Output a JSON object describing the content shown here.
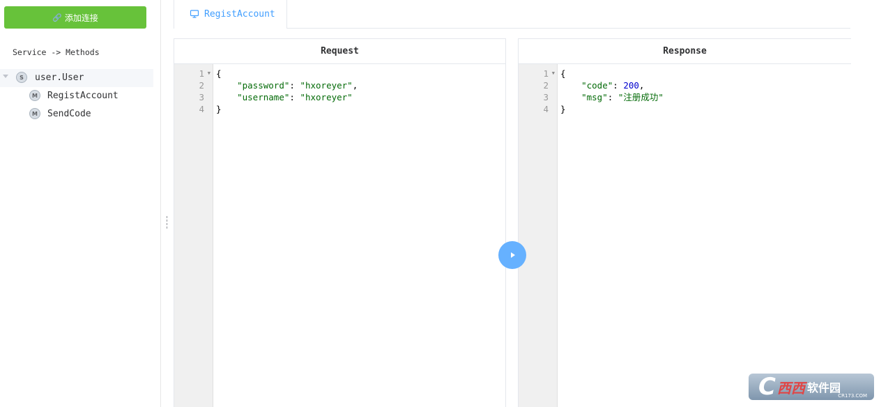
{
  "sidebar": {
    "add_button_label": "添加连接",
    "header": "Service -> Methods",
    "service": {
      "badge": "S",
      "name": "user.User"
    },
    "methods": [
      {
        "badge": "M",
        "name": "RegistAccount"
      },
      {
        "badge": "M",
        "name": "SendCode"
      }
    ]
  },
  "tabs": [
    {
      "label": "RegistAccount",
      "active": true
    }
  ],
  "request": {
    "title": "Request",
    "line_numbers": [
      "1",
      "2",
      "3",
      "4"
    ],
    "code": {
      "open": "{",
      "password_key": "\"password\"",
      "password_val": "\"hxoreyer\"",
      "username_key": "\"username\"",
      "username_val": "\"hxoreyer\"",
      "close": "}"
    }
  },
  "response": {
    "title": "Response",
    "line_numbers": [
      "1",
      "2",
      "3",
      "4"
    ],
    "code": {
      "open": "{",
      "code_key": "\"code\"",
      "code_val": "200",
      "msg_key": "\"msg\"",
      "msg_val": "\"注册成功\"",
      "close": "}"
    }
  },
  "watermark": {
    "c": "C",
    "brand1": "西西",
    "brand2": "软件园",
    "domain": "CR173.COM"
  },
  "colors": {
    "accent": "#409eff",
    "success": "#67c23a",
    "run_button": "#66b1ff",
    "string": "#036a07",
    "number": "#0000cd"
  }
}
